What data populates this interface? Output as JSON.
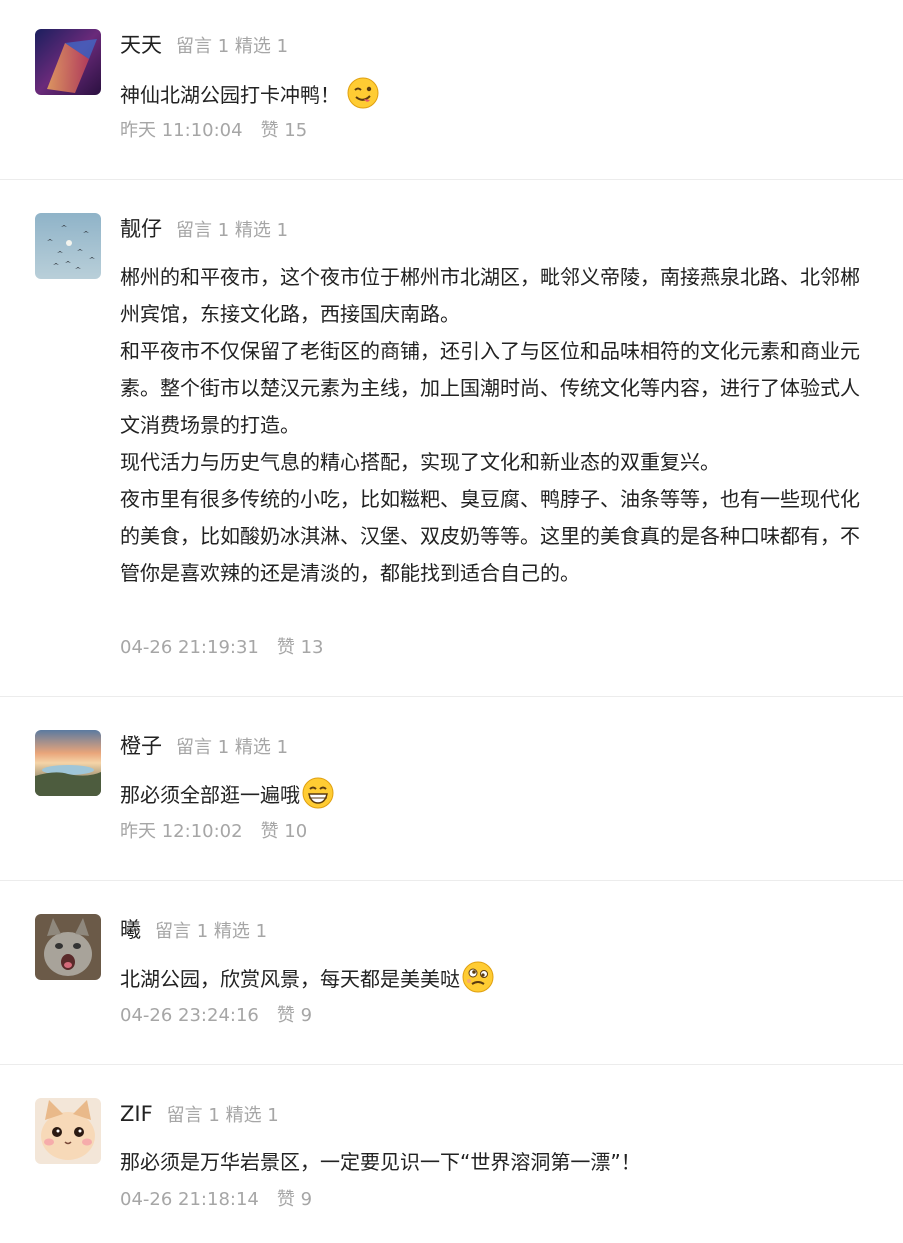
{
  "comments": [
    {
      "name": "天天",
      "stats": "留言 1 精选 1",
      "text": "神仙北湖公园打卡冲鸭！",
      "emoji": "wink-tongue-emoji-icon",
      "time": "昨天 11:10:04",
      "likes": "赞 15"
    },
    {
      "name": "靓仔",
      "stats": "留言 1 精选 1",
      "text": "郴州的和平夜市，这个夜市位于郴州市北湖区，毗邻义帝陵，南接燕泉北路、北邻郴州宾馆，东接文化路，西接国庆南路。\n和平夜市不仅保留了老街区的商铺，还引入了与区位和品味相符的文化元素和商业元素。整个街市以楚汉元素为主线，加上国潮时尚、传统文化等内容，进行了体验式人文消费场景的打造。\n现代活力与历史气息的精心搭配，实现了文化和新业态的双重复兴。\n夜市里有很多传统的小吃，比如糍粑、臭豆腐、鸭脖子、油条等等，也有一些现代化的美食，比如酸奶冰淇淋、汉堡、双皮奶等等。这里的美食真的是各种口味都有，不管你是喜欢辣的还是清淡的，都能找到适合自己的。",
      "time": "04-26 21:19:31",
      "likes": "赞 13"
    },
    {
      "name": "橙子",
      "stats": "留言 1 精选 1",
      "text": "那必须全部逛一遍哦",
      "emoji": "grin-emoji-icon",
      "time": "昨天 12:10:02",
      "likes": "赞 10"
    },
    {
      "name": "曦",
      "stats": "留言 1 精选 1",
      "text": "北湖公园，欣赏风景，每天都是美美哒",
      "emoji": "silly-emoji-icon",
      "time": "04-26 23:24:16",
      "likes": "赞 9"
    },
    {
      "name": "ZIF",
      "stats": "留言 1 精选 1",
      "text": "那必须是万华岩景区，一定要见识一下“世界溶洞第一漂”！",
      "time": "04-26 21:18:14",
      "likes": "赞 9"
    }
  ]
}
